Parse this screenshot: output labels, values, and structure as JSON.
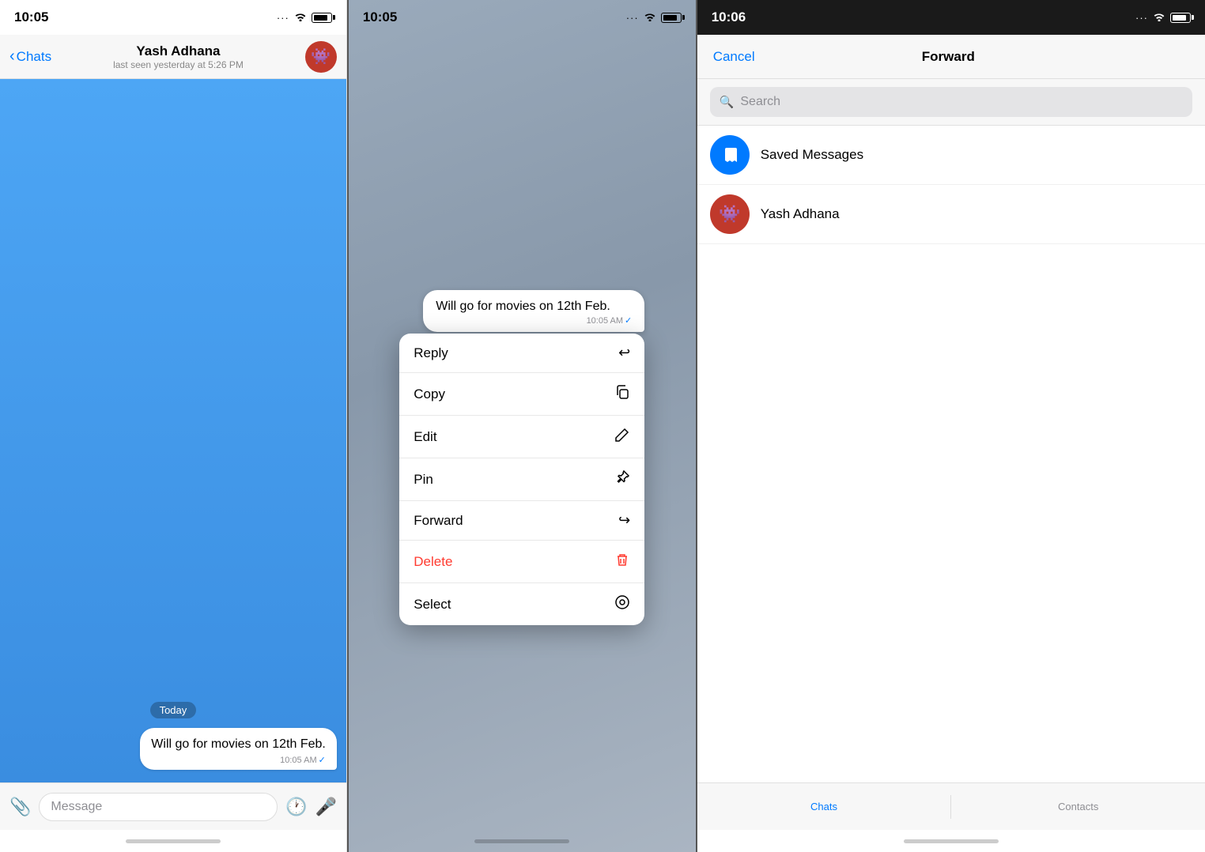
{
  "panel1": {
    "status": {
      "time": "10:05"
    },
    "nav": {
      "back_label": "Chats",
      "title": "Yash Adhana",
      "subtitle": "last seen yesterday at 5:26 PM"
    },
    "messages": [
      {
        "text": "Will go for movies on 12th Feb.",
        "time": "10:05 AM",
        "read": true
      }
    ],
    "date_badge": "Today",
    "input_placeholder": "Message"
  },
  "panel2": {
    "status": {
      "time": "10:05"
    },
    "bubble": {
      "text": "Will go for movies on 12th Feb.",
      "time": "10:05 AM",
      "read": true
    },
    "menu": {
      "items": [
        {
          "label": "Reply",
          "icon": "↩",
          "type": "normal"
        },
        {
          "label": "Copy",
          "icon": "⧉",
          "type": "normal"
        },
        {
          "label": "Edit",
          "icon": "✏",
          "type": "normal"
        },
        {
          "label": "Pin",
          "icon": "📌",
          "type": "normal"
        },
        {
          "label": "Forward",
          "icon": "↪",
          "type": "normal"
        },
        {
          "label": "Delete",
          "icon": "🗑",
          "type": "delete"
        },
        {
          "label": "Select",
          "icon": "◎",
          "type": "normal"
        }
      ]
    }
  },
  "panel3": {
    "status": {
      "time": "10:06"
    },
    "nav": {
      "cancel_label": "Cancel",
      "title": "Forward"
    },
    "search": {
      "placeholder": "Search"
    },
    "contacts": [
      {
        "name": "Saved Messages",
        "type": "saved",
        "icon": "🔖"
      },
      {
        "name": "Yash Adhana",
        "type": "person",
        "icon": "👾"
      }
    ],
    "tabs": [
      {
        "label": "Chats",
        "active": true
      },
      {
        "label": "Contacts",
        "active": false
      }
    ]
  }
}
